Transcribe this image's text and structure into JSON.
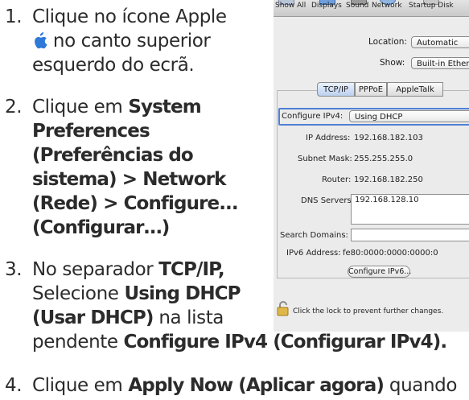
{
  "steps": [
    {
      "number": "1.",
      "lines": [
        [
          "Clique no ícone Apple"
        ],
        [
          "no canto superior"
        ],
        [
          "esquerdo do ecrã."
        ]
      ]
    },
    {
      "number": "2.",
      "lines": [
        [
          {
            "t": "Clique em ",
            "b": false
          },
          {
            "t": "System",
            "b": true
          }
        ],
        [
          {
            "t": "Preferences",
            "b": true
          }
        ],
        [
          {
            "t": "(Preferências do",
            "b": true
          }
        ],
        [
          {
            "t": "sistema) > Network",
            "b": true
          }
        ],
        [
          {
            "t": "(Rede) > Configure...",
            "b": true
          }
        ],
        [
          {
            "t": "(Configurar…)",
            "b": true
          }
        ]
      ]
    },
    {
      "number": "3.",
      "lines": [
        [
          {
            "t": "No separador ",
            "b": false
          },
          {
            "t": "TCP/IP,",
            "b": true
          }
        ],
        [
          {
            "t": "Selecione ",
            "b": false
          },
          {
            "t": "Using DHCP",
            "b": true
          }
        ],
        [
          {
            "t": "(Usar DHCP)",
            "b": true
          },
          {
            "t": " na lista",
            "b": false
          }
        ],
        [
          {
            "t": "pendente ",
            "b": false
          },
          {
            "t": "Configure IPv4 (Configurar IPv4).",
            "b": true
          }
        ]
      ]
    },
    {
      "number": "4.",
      "lines": [
        [
          {
            "t": "Clique em ",
            "b": false
          },
          {
            "t": "Apply Now (Aplicar agora)",
            "b": true
          },
          {
            "t": " quando",
            "b": false
          }
        ]
      ]
    }
  ],
  "mac_window": {
    "toolbar": {
      "items": [
        {
          "label": "Show All",
          "icon": "show-all-icon"
        },
        {
          "label": "Displays",
          "icon": "displays-icon"
        },
        {
          "label": "Sound",
          "icon": "sound-icon"
        },
        {
          "label": "Network",
          "icon": "network-icon"
        },
        {
          "label": "Startup Disk",
          "icon": "startup-disk-icon"
        }
      ]
    },
    "location_label": "Location:",
    "location_value": "Automatic",
    "show_label": "Show:",
    "show_value": "Built-in Ethernet",
    "tabs": [
      "TCP/IP",
      "PPPoE",
      "AppleTalk"
    ],
    "selected_tab": "TCP/IP",
    "configure_label": "Configure IPv4:",
    "configure_value": "Using DHCP",
    "ip_label": "IP Address:",
    "ip_value": "192.168.182.103",
    "subnet_label": "Subnet Mask:",
    "subnet_value": "255.255.255.0",
    "router_label": "Router:",
    "router_value": "192.168.182.250",
    "dns_label": "DNS Servers:",
    "dns_value": "192.168.128.10",
    "search_label": "Search Domains:",
    "search_value": "",
    "ipv6_label": "IPv6 Address:",
    "ipv6_value": "fe80:0000:0000:0000:0",
    "configure_ipv6_button": "Configure IPv6...",
    "lock_text": "Click the lock to prevent further changes."
  },
  "colors": {
    "apple_logo": "#2f79d8",
    "highlight_border": "#4f7fd4"
  }
}
